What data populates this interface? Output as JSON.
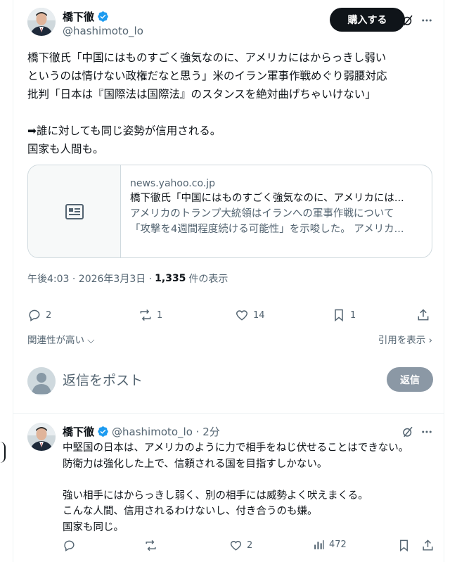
{
  "main_post": {
    "author_name": "橋下徹",
    "author_handle": "@hashimoto_lo",
    "buy_button": "購入する",
    "text": "橋下徹氏「中国にはものすごく強気なのに、アメリカにはからっきし弱い\nというのは情けない政権だなと思う」米のイラン軍事作戦めぐり弱腰対応\n批判「日本は『国際法は国際法』のスタンスを絶対曲げちゃいけない」\n\n➡誰に対しても同じ姿勢が信用される。\n国家も人間も。",
    "card": {
      "domain": "news.yahoo.co.jp",
      "title": "橋下徹氏「中国にはものすごく強気なのに、アメリカには...",
      "description_line1": "アメリカのトランプ大統領はイランへの軍事作戦について",
      "description_line2": "「攻撃を4週間程度続ける可能性」を示唆した。 アメリカ..."
    },
    "meta": {
      "time": "午後4:03 · 2026年3月3日 ·",
      "views": "1,335",
      "views_label": "件の表示"
    },
    "stats": {
      "replies": "2",
      "reposts": "1",
      "likes": "14",
      "bookmarks": "1"
    }
  },
  "sort": {
    "left": "関連性が高い",
    "right": "引用を表示"
  },
  "reply_box": {
    "placeholder": "返信をポスト",
    "button": "返信"
  },
  "reply_post": {
    "author_name": "橋下徹",
    "author_handle": "@hashimoto_lo · 2分",
    "text": "中堅国の日本は、アメリカのように力で相手をねじ伏せることはできない。\n防衛力は強化した上で、信頼される国を目指すしかない。\n\n強い相手にはからっきし弱く、別の相手には威勢よく吠えまくる。\nこんな人間、信用されるわけないし、付き合うのも嫌。\n国家も同じ。",
    "stats": {
      "replies": "",
      "reposts": "",
      "likes": "2",
      "views": "472"
    }
  },
  "colors": {
    "text": "#0f1419",
    "secondary": "#536471",
    "verified": "#1d9bf0",
    "border": "#cfd9de"
  }
}
